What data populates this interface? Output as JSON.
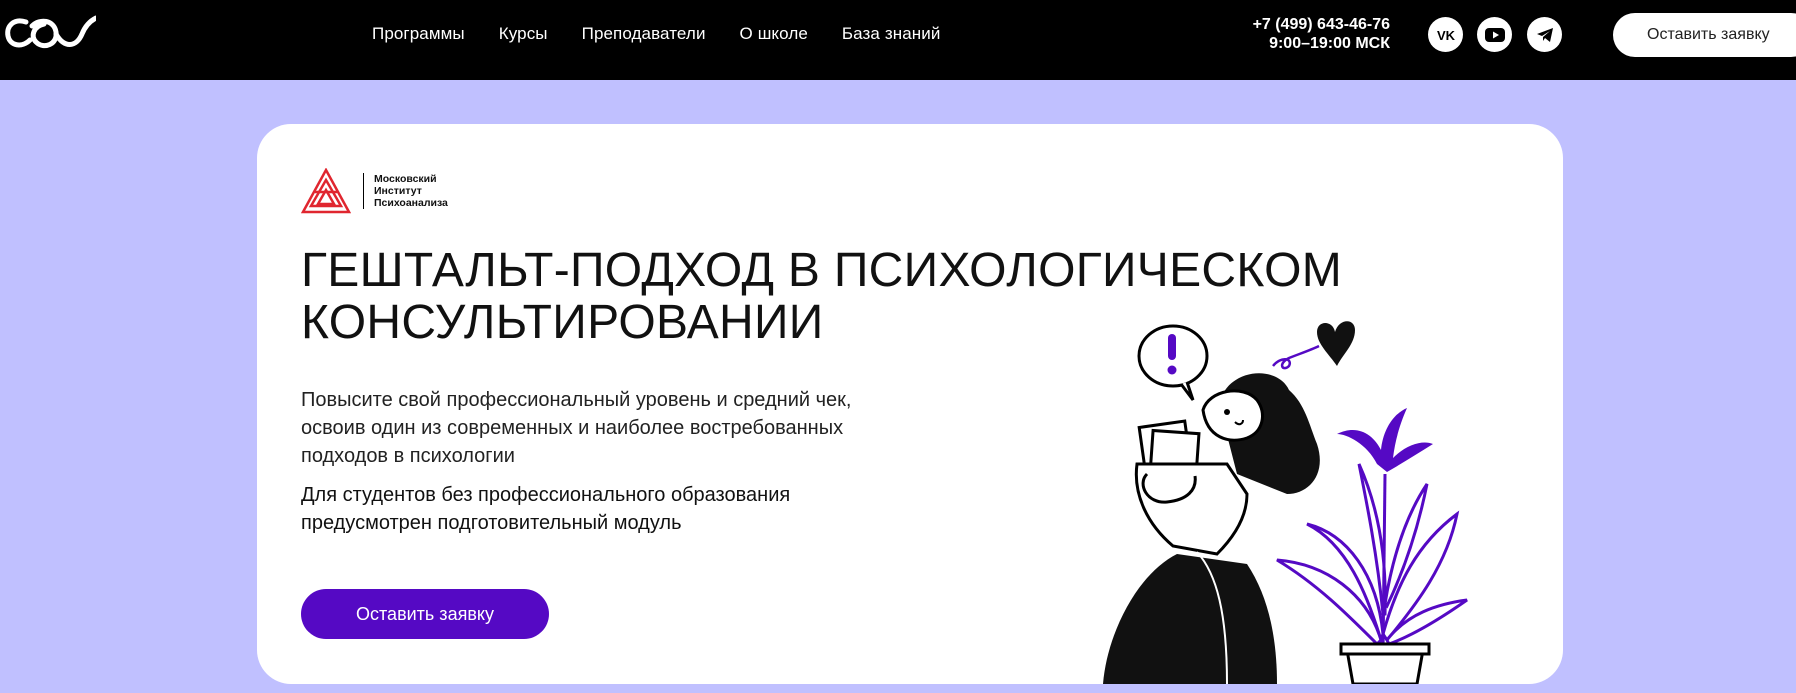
{
  "header": {
    "logo_icon": "co-logo-icon",
    "nav": [
      {
        "label": "Программы"
      },
      {
        "label": "Курсы"
      },
      {
        "label": "Преподаватели"
      },
      {
        "label": "О школе"
      },
      {
        "label": "База знаний"
      }
    ],
    "phone": "+7 (499) 643-46-76",
    "hours": "9:00–19:00 МСК",
    "social": [
      {
        "icon": "vk-icon"
      },
      {
        "icon": "youtube-icon"
      },
      {
        "icon": "telegram-icon"
      }
    ],
    "cta_label": "Оставить заявку"
  },
  "hero": {
    "partner": {
      "lines": [
        "Московский",
        "Институт",
        "Психоанализа"
      ],
      "logo_color": "#e0262f"
    },
    "title_lines": [
      "ГЕШТАЛЬТ-ПОДХОД В ПСИХОЛОГИЧЕСКОМ",
      "КОНСУЛЬТИРОВАНИИ"
    ],
    "description_lines": [
      "Повысите свой профессиональный уровень и средний чек,",
      "освоив один из современных и наиболее востребованных",
      "подходов в психологии"
    ],
    "note_lines": [
      "Для студентов без профессионального образования",
      "предусмотрен подготовительный модуль"
    ],
    "cta_label": "Оставить заявку"
  },
  "colors": {
    "background": "#c0c0ff",
    "header_bg": "#000000",
    "accent": "#5509c4",
    "card_bg": "#ffffff"
  }
}
